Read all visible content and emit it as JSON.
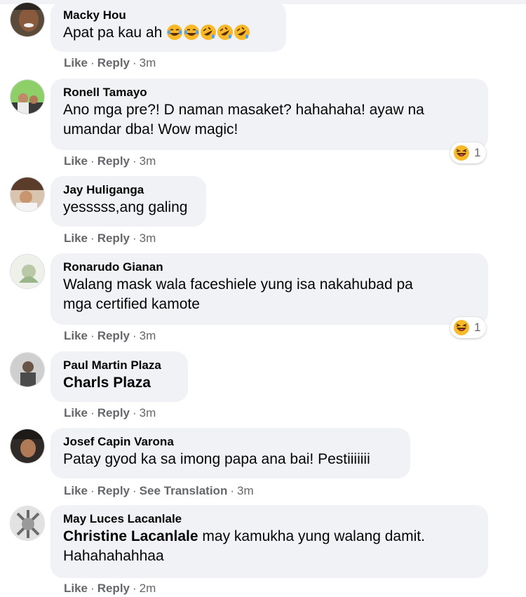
{
  "comments": [
    {
      "author": "Macky Hou",
      "text": "Apat pa kau ah",
      "emojis": [
        "joy",
        "joy",
        "rofl",
        "rofl",
        "rofl"
      ],
      "like": "Like",
      "reply": "Reply",
      "time": "3m"
    },
    {
      "author": "Ronell Tamayo",
      "text_lines": [
        "Ano mga pre?! D naman masaket? hahahaha! ayaw na",
        "umandar dba! Wow magic!"
      ],
      "like": "Like",
      "reply": "Reply",
      "time": "3m",
      "reaction_count": "1"
    },
    {
      "author": "Jay Huliganga",
      "text": "yesssss,ang galing",
      "like": "Like",
      "reply": "Reply",
      "time": "3m"
    },
    {
      "author": "Ronarudo Gianan",
      "text_lines": [
        "Walang mask wala faceshiele yung isa nakahubad pa",
        "mga certified kamote"
      ],
      "like": "Like",
      "reply": "Reply",
      "time": "3m",
      "reaction_count": "1"
    },
    {
      "author": "Paul Martin Plaza",
      "mention": "Charls Plaza",
      "like": "Like",
      "reply": "Reply",
      "time": "3m"
    },
    {
      "author": "Josef Capin Varona",
      "text": "Patay gyod ka sa imong papa ana bai! Pestiiiiiii",
      "like": "Like",
      "reply": "Reply",
      "translate": "See Translation",
      "time": "3m"
    },
    {
      "author": "May Luces Lacanlale",
      "mention": "Christine Lacanlale",
      "text_after_mention": " may kamukha yung walang damit.",
      "text_line2": "Hahahahahhaa",
      "like": "Like",
      "reply": "Reply",
      "time": "2m"
    }
  ],
  "colors": {
    "bubble": "#f0f2f5",
    "meta": "#65676b",
    "text": "#050505"
  }
}
